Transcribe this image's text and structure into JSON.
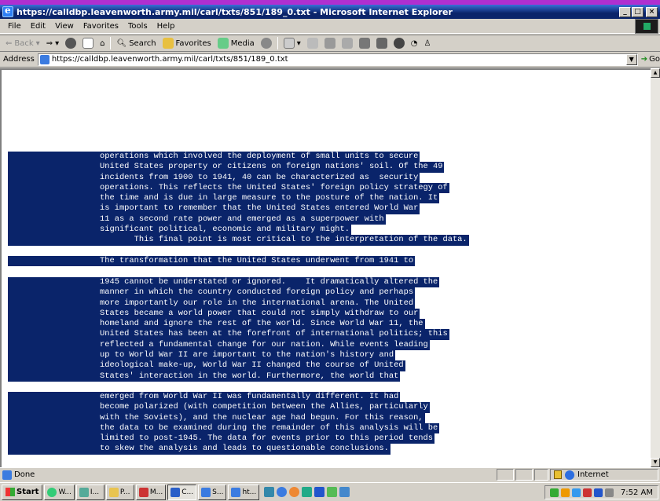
{
  "window": {
    "title": "https://calldbp.leavenworth.army.mil/carl/txts/851/189_0.txt - Microsoft Internet Explorer"
  },
  "menu": [
    "File",
    "Edit",
    "View",
    "Favorites",
    "Tools",
    "Help"
  ],
  "toolbar": {
    "back": "Back",
    "search": "Search",
    "favorites": "Favorites",
    "media": "Media"
  },
  "address": {
    "label": "Address",
    "value": "https://calldbp.leavenworth.army.mil/carl/txts/851/189_0.txt",
    "go": "Go"
  },
  "document": {
    "paragraphs": [
      [
        "operations which involved the deployment of small units to secure",
        "United States property or citizens on foreign nations' soil. Of the 49",
        "incidents from 1900 to 1941, 40 can be characterized as  security",
        "operations. This reflects the United States' foreign policy strategy of",
        "the time and is due in large measure to the posture of the nation. It",
        "is important to remember that the United States entered World War",
        "11 as a second rate power and emerged as a superpower with",
        "significant political, economic and military might.",
        "       This final point is most critical to the interpretation of the data."
      ],
      [
        "The transformation that the United States underwent from 1941 to"
      ],
      [
        "1945 cannot be understated or ignored.    It dramatically altered the",
        "manner in which the country conducted foreign policy and perhaps",
        "more importantly our role in the international arena. The United",
        "States became a world power that could not simply withdraw to our",
        "homeland and ignore the rest of the world. Since World War 11, the",
        "United States has been at the forefront of international politics; this",
        "reflected a fundamental change for our nation. While events leading",
        "up to World War II are important to the nation's history and",
        "ideological make-up, World War II changed the course of United",
        "States' interaction in the world. Furthermore, the world that"
      ],
      [
        "emerged from World War II was fundamentally different. It had",
        "become polarized (with competition between the Allies, particularly",
        "with the Soviets), and the nuclear age had begun. For this reason,",
        "the data to be examined during the remainder of this analysis will be",
        "limited to post-1945. The data for events prior to this period tends",
        "to skew the analysis and leads to questionable conclusions."
      ]
    ]
  },
  "status": {
    "text": "Done",
    "zone": "Internet"
  },
  "taskbar": {
    "start": "Start",
    "tasks": [
      "W...",
      "I...",
      "P...",
      "M...",
      "C...",
      "S...",
      "ht..."
    ],
    "clock": "7:52 AM"
  }
}
